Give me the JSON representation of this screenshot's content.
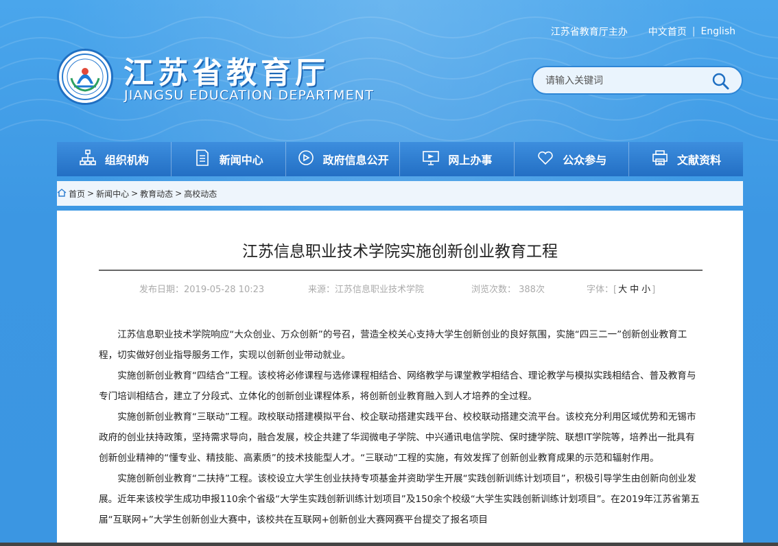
{
  "header": {
    "host_text": "江苏省教育厅主办",
    "lang_cn": "中文首页",
    "lang_sep": "|",
    "lang_en": "English",
    "title": "江苏省教育厅",
    "subtitle": "JIANGSU EDUCATION DEPARTMENT",
    "logo_icon": "education-department-emblem-icon"
  },
  "search": {
    "placeholder": "请输入关键词",
    "icon": "search-icon"
  },
  "nav": {
    "items": [
      {
        "label": "组织机构",
        "icon": "org-chart-icon"
      },
      {
        "label": "新闻中心",
        "icon": "document-icon"
      },
      {
        "label": "政府信息公开",
        "icon": "announcement-icon"
      },
      {
        "label": "网上办事",
        "icon": "monitor-icon"
      },
      {
        "label": "公众参与",
        "icon": "heart-icon"
      },
      {
        "label": "文献资料",
        "icon": "printer-icon"
      }
    ]
  },
  "breadcrumb": {
    "home": "首页",
    "items": [
      "新闻中心",
      "教育动态",
      "高校动态"
    ],
    "sep": ">"
  },
  "article": {
    "title": "江苏信息职业技术学院实施创新创业教育工程",
    "publish_date": "发布日期：2019-05-28 10:23",
    "source": "来源：江苏信息职业技术学院",
    "views": "浏览次数： 388次",
    "font_size_label": "字体：[",
    "font_large": "大",
    "font_medium": "中",
    "font_small": "小",
    "font_close": "]",
    "paragraphs": [
      "江苏信息职业技术学院响应“大众创业、万众创新”的号召，营造全校关心支持大学生创新创业的良好氛围，实施“四三二一”创新创业教育工程，切实做好创业指导服务工作，实现以创新创业带动就业。",
      "实施创新创业教育“四结合”工程。该校将必修课程与选修课程相结合、网络教学与课堂教学相结合、理论教学与模拟实践相结合、普及教育与专门培训相结合，建立了分段式、立体化的创新创业课程体系，将创新创业教育融入到人才培养的全过程。",
      "实施创新创业教育“三联动”工程。政校联动搭建模拟平台、校企联动搭建实践平台、校校联动搭建交流平台。该校充分利用区域优势和无锡市政府的创业扶持政策，坚持需求导向，融合发展，校企共建了华润微电子学院、中兴通讯电信学院、保时捷学院、联想IT学院等，培养出一批具有创新创业精神的“懂专业、精技能、高素质”的技术技能型人才。“三联动”工程的实施，有效发挥了创新创业教育成果的示范和辐射作用。",
      "实施创新创业教育“二扶持”工程。该校设立大学生创业扶持专项基金并资助学生开展“实践创新训练计划项目”，积极引导学生由创新向创业发展。近年来该校学生成功申报110余个省级“大学生实践创新训练计划项目”及150余个校级“大学生实践创新训练计划项目”。在2019年江苏省第五届“互联网+”大学生创新创业大赛中，该校共在互联网+创新创业大赛网赛平台提交了报名项目"
    ]
  },
  "colors": {
    "background": "#3d9be6",
    "nav": "#236fc4",
    "accent": "#1f6fc2"
  }
}
